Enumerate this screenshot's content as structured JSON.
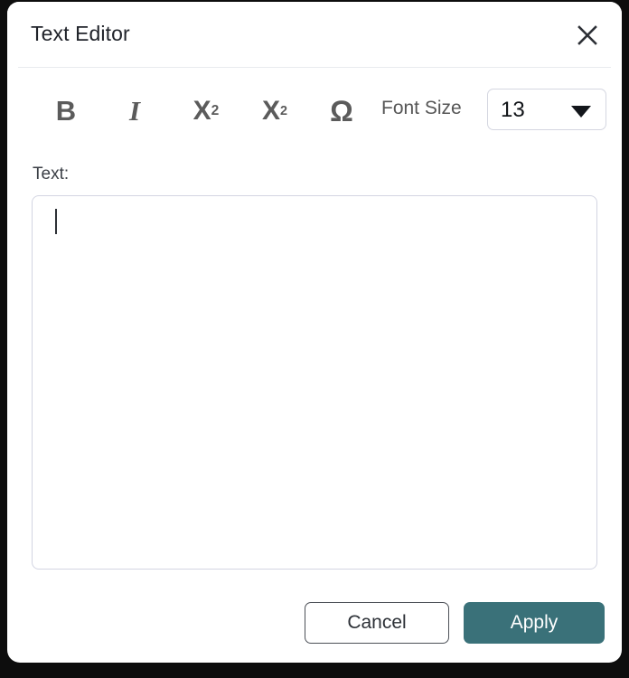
{
  "dialog": {
    "title": "Text Editor",
    "close_icon": "close-x-icon"
  },
  "toolbar": {
    "bold_label": "B",
    "italic_label": "I",
    "subscript_base": "X",
    "subscript_index": "2",
    "superscript_base": "X",
    "superscript_index": "2",
    "special_char_label": "Ω",
    "font_size_label": "Font Size",
    "font_size_value": "13",
    "font_size_caret_icon": "chevron-down-icon"
  },
  "body": {
    "text_field_label": "Text:",
    "text_field_value": "",
    "text_field_placeholder": ""
  },
  "footer": {
    "cancel_label": "Cancel",
    "apply_label": "Apply"
  },
  "colors": {
    "accent": "#3a7179",
    "toolbar_icon": "#5b5b5b",
    "border": "#d3d5e2",
    "title_text": "#20232a"
  }
}
